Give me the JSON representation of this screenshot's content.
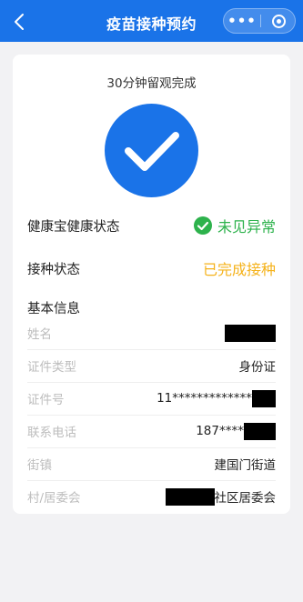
{
  "header": {
    "title": "疫苗接种预约",
    "back_icon": "chevron-left-icon",
    "more_icon": "more-dots-icon",
    "close_icon": "capsule-close-icon",
    "bg_color": "#1a73e8"
  },
  "card": {
    "observation_text": "30分钟留观完成",
    "success_icon": "check-circle-icon",
    "health_status": {
      "label": "健康宝健康状态",
      "value": "未见异常",
      "color": "#2db24c"
    },
    "vaccination_status": {
      "label": "接种状态",
      "value": "已完成接种",
      "color": "#f5b21a"
    },
    "basic_info": {
      "title": "基本信息",
      "rows": [
        {
          "label": "姓名",
          "value": ""
        },
        {
          "label": "证件类型",
          "value": "身份证"
        },
        {
          "label": "证件号",
          "value": "11*************"
        },
        {
          "label": "联系电话",
          "value": "187****"
        },
        {
          "label": "街镇",
          "value": "建国门街道"
        },
        {
          "label": "村/居委会",
          "value": "社区居委会"
        }
      ]
    }
  }
}
